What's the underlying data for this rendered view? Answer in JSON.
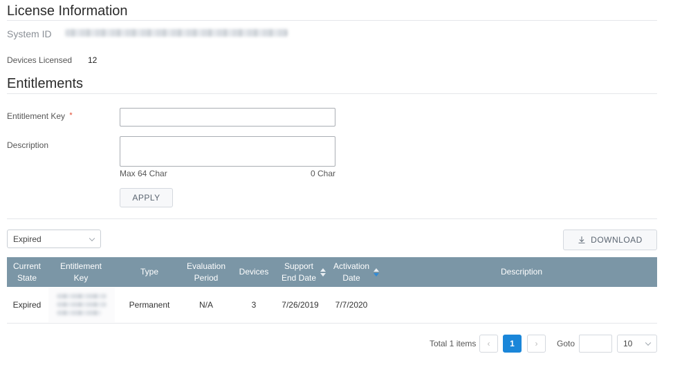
{
  "license": {
    "title": "License Information",
    "system_id_label": "System ID",
    "devices_licensed_label": "Devices Licensed",
    "devices_licensed_value": "12"
  },
  "entitlements": {
    "title": "Entitlements",
    "key_label": "Entitlement Key",
    "required_mark": "*",
    "key_value": "",
    "description_label": "Description",
    "description_value": "",
    "max_char_hint": "Max 64 Char",
    "char_count": "0 Char",
    "apply_label": "APPLY"
  },
  "filter": {
    "selected": "Expired"
  },
  "toolbar": {
    "download_label": "DOWNLOAD"
  },
  "table": {
    "headers": {
      "current_state": [
        "Current",
        "State"
      ],
      "entitlement_key": [
        "Entitlement",
        "Key"
      ],
      "type": "Type",
      "evaluation_period": [
        "Evaluation",
        "Period"
      ],
      "devices": "Devices",
      "support_end_date": [
        "Support",
        "End Date"
      ],
      "activation_date": [
        "Activation",
        "Date"
      ],
      "description": "Description"
    },
    "rows": [
      {
        "current_state": "Expired",
        "type": "Permanent",
        "evaluation_period": "N/A",
        "devices": "3",
        "support_end_date": "7/26/2019",
        "activation_date": "7/7/2020",
        "description": ""
      }
    ]
  },
  "pagination": {
    "total_label": "Total 1 items",
    "prev": "‹",
    "current_page": "1",
    "next": "›",
    "goto_label": "Goto",
    "goto_value": "",
    "page_size": "10"
  },
  "colors": {
    "table_header_bg": "#7b96a6",
    "active_page": "#1a86d9",
    "required": "#e0442b"
  },
  "icons": {
    "download": "download-icon",
    "dropdown": "chevron-down-icon",
    "sort": "sort-icon"
  }
}
